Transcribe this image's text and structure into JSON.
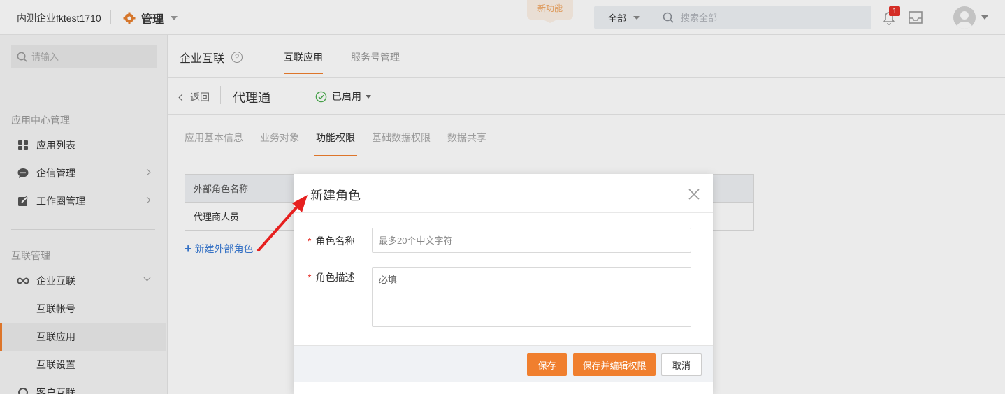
{
  "header": {
    "company": "内测企业fktest1710",
    "section": "管理",
    "new_feature": "新功能",
    "scope": "全部",
    "search_placeholder": "搜索全部",
    "notification_count": "1"
  },
  "sidebar": {
    "search_placeholder": "请输入",
    "group1": "应用中心管理",
    "items1": [
      {
        "label": "应用列表",
        "icon": "grid-icon"
      },
      {
        "label": "企信管理",
        "icon": "chat-icon"
      },
      {
        "label": "工作圈管理",
        "icon": "edit-icon"
      }
    ],
    "group2": "互联管理",
    "interconnect": "企业互联",
    "sub_items": [
      "互联帐号",
      "互联应用",
      "互联设置"
    ],
    "customer": "客户互联"
  },
  "main": {
    "title": "企业互联",
    "help": "?",
    "tabs": [
      "互联应用",
      "服务号管理"
    ],
    "back": "返回",
    "app_name": "代理通",
    "status": "已启用",
    "sub_tabs": [
      "应用基本信息",
      "业务对象",
      "功能权限",
      "基础数据权限",
      "数据共享"
    ],
    "table_header": "外部角色名称",
    "table_row": "代理商人员",
    "add_role": "新建外部角色"
  },
  "modal": {
    "title": "新建角色",
    "name_label": "角色名称",
    "name_placeholder": "最多20个中文字符",
    "desc_label": "角色描述",
    "desc_placeholder": "必填",
    "required_mark": "*",
    "save": "保存",
    "save_edit": "保存并编辑权限",
    "cancel": "取消"
  },
  "colors": {
    "accent": "#f07f2e",
    "link": "#3a7bd5",
    "required": "#e6312a"
  }
}
